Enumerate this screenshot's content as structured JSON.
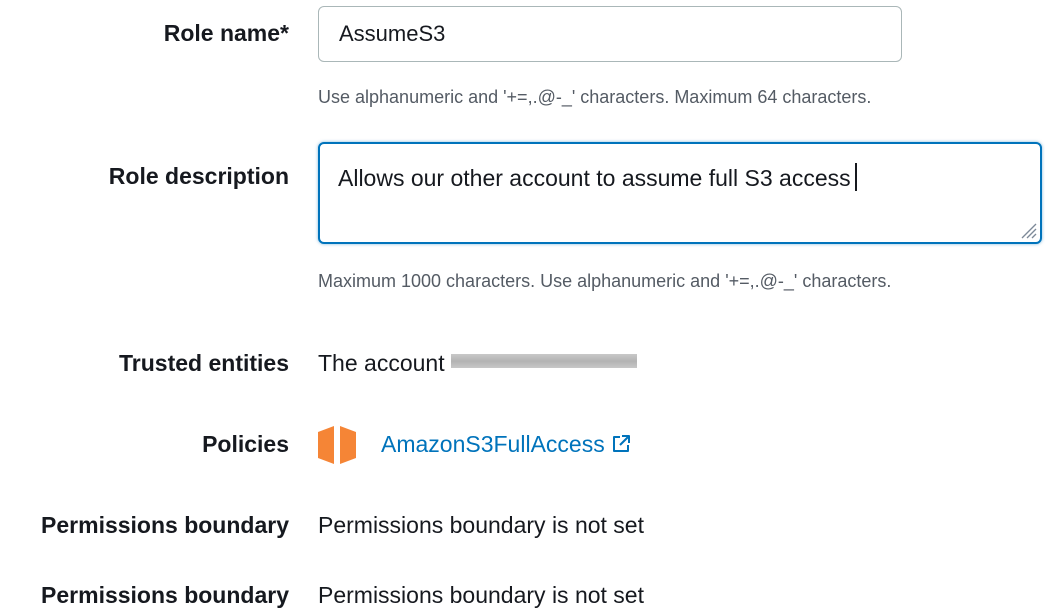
{
  "role_name": {
    "label": "Role name*",
    "value": "AssumeS3",
    "hint": "Use alphanumeric and '+=,.@-_' characters. Maximum 64 characters."
  },
  "role_description": {
    "label": "Role description",
    "value": "Allows our other account to assume full S3 access",
    "hint": "Maximum 1000 characters. Use alphanumeric and '+=,.@-_' characters."
  },
  "trusted_entities": {
    "label": "Trusted entities",
    "value": "The account"
  },
  "policies": {
    "label": "Policies",
    "items": [
      {
        "name": "AmazonS3FullAccess",
        "icon": "aws-policy-cube-icon"
      }
    ]
  },
  "permissions_boundary": [
    {
      "label": "Permissions boundary",
      "value": "Permissions boundary is not set"
    },
    {
      "label": "Permissions boundary",
      "value": "Permissions boundary is not set"
    }
  ],
  "colors": {
    "link": "#0073bb",
    "focus_border": "#0073bb",
    "policy_icon": "#f58536",
    "hint_text": "#545b64"
  }
}
